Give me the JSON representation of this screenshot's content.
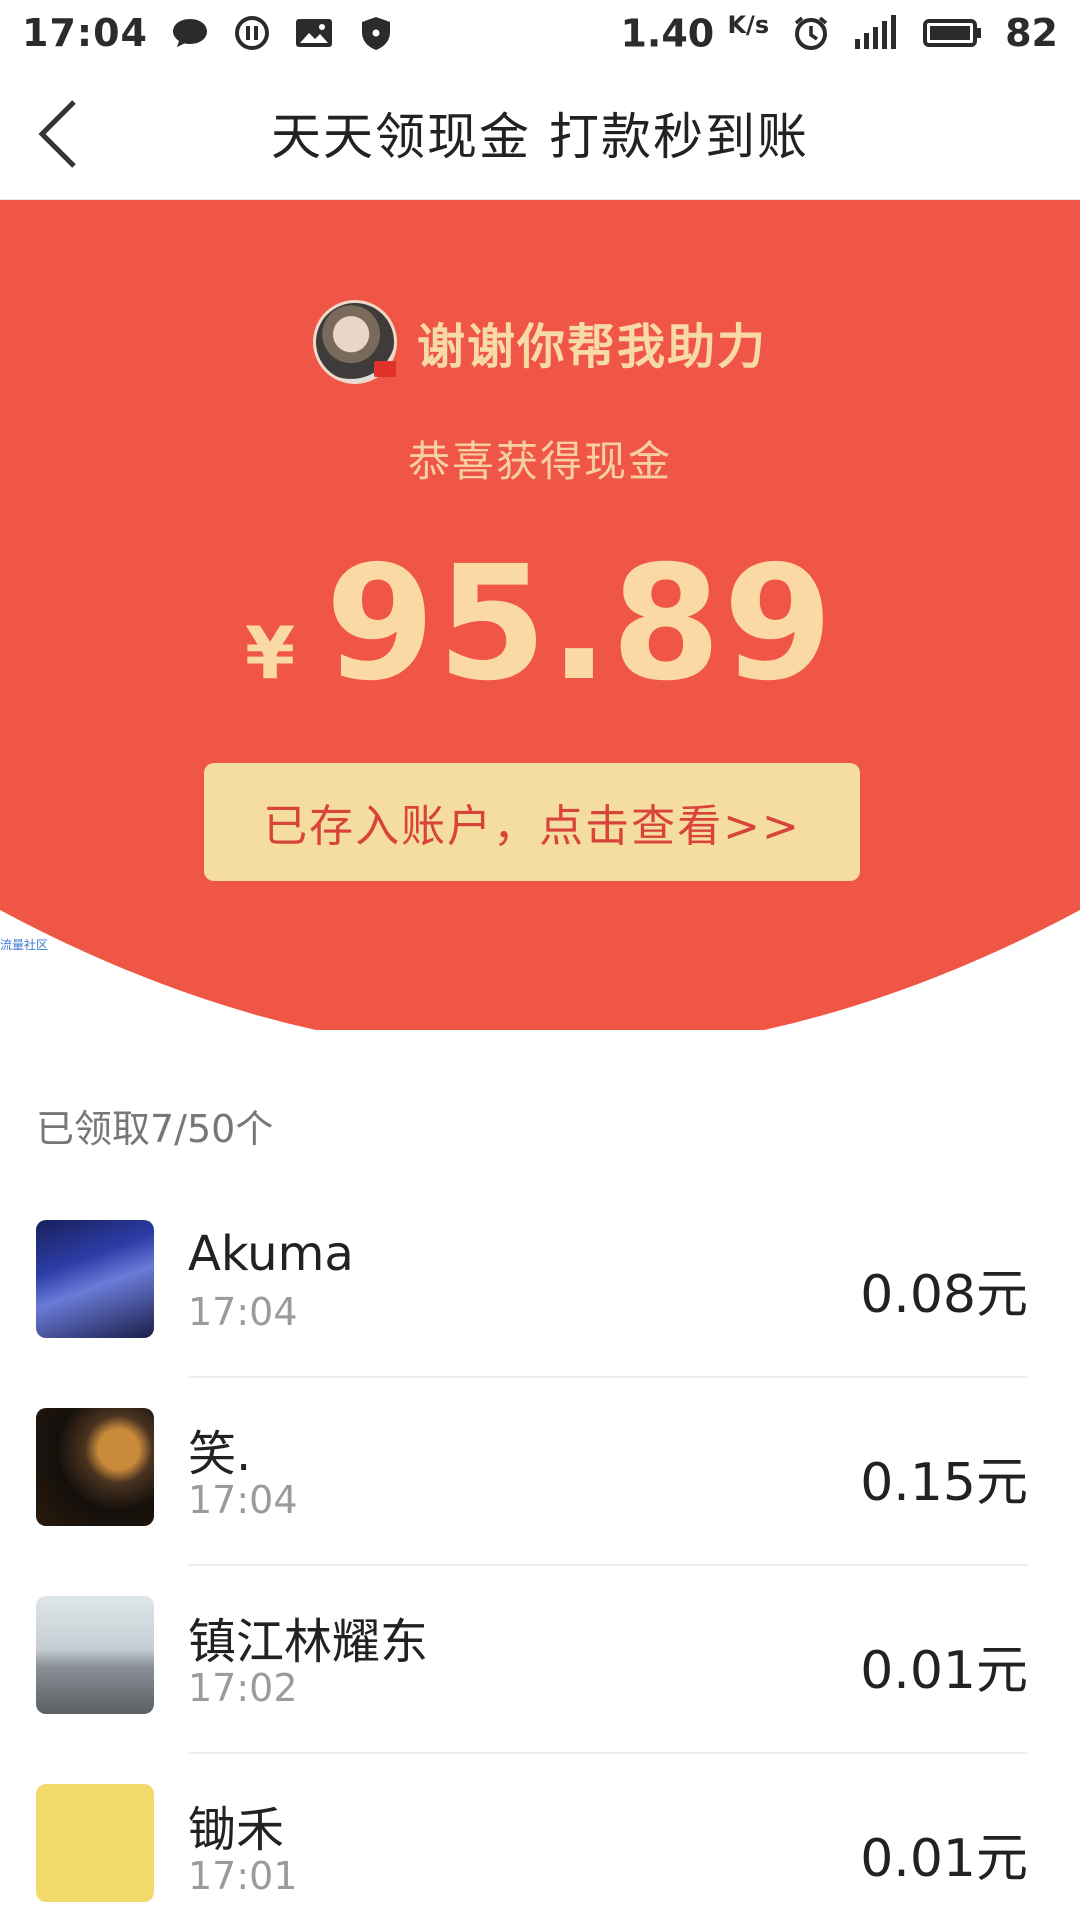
{
  "status_bar": {
    "time": "17:04",
    "speed": "1.40",
    "speed_unit": "K/s",
    "battery": "82",
    "icons": [
      "chat-bubble-icon",
      "pause-circle-icon",
      "image-icon",
      "shield-icon",
      "alarm-icon",
      "signal-4g-icon",
      "battery-icon"
    ]
  },
  "header": {
    "title": "天天领现金 打款秒到账",
    "back_icon": "chevron-left-icon"
  },
  "hero": {
    "helper_text": "谢谢你帮我助力",
    "congrats": "恭喜获得现金",
    "currency": "¥",
    "amount": "95.89",
    "cta_label": "已存入账户，点击查看>>",
    "watermark": "流量社区",
    "colors": {
      "red": "#f05645",
      "gold_text": "#fbd9a4",
      "cta_bg": "#f5dda0",
      "cta_text": "#d8433a"
    }
  },
  "received": {
    "label": "已领取7/50个"
  },
  "list": [
    {
      "name": "Akuma",
      "time": "17:04",
      "money": "0.08元"
    },
    {
      "name": "笑.",
      "time": "17:04",
      "money": "0.15元"
    },
    {
      "name": "镇江林耀东",
      "time": "17:02",
      "money": "0.01元"
    },
    {
      "name": "锄禾",
      "time": "17:01",
      "money": "0.01元"
    }
  ]
}
